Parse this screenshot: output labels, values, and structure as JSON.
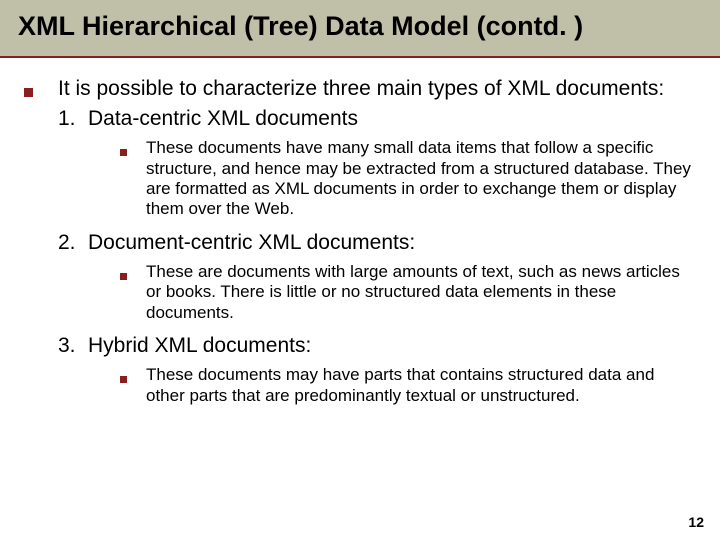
{
  "title": "XML Hierarchical (Tree) Data Model (contd. )",
  "intro": "It is possible to characterize three main types of XML documents:",
  "items": [
    {
      "num": "1.",
      "heading": "Data-centric XML documents",
      "desc": "These documents have many small data items that follow a specific structure, and hence may be extracted from a structured database. They are formatted as XML documents in order to exchange them or display them over the Web."
    },
    {
      "num": "2.",
      "heading": "Document-centric XML documents:",
      "desc": "These are documents with large amounts of text, such as news articles or books. There is little or no structured data elements in these documents."
    },
    {
      "num": "3.",
      "heading": "Hybrid XML documents:",
      "desc": "These documents may have parts that contains structured data and other parts that are predominantly textual or unstructured."
    }
  ],
  "page_number": "12"
}
